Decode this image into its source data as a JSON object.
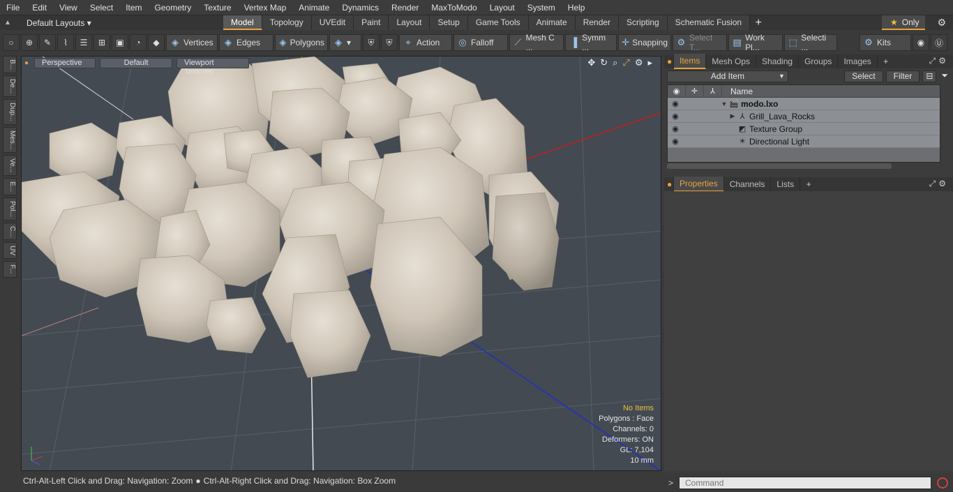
{
  "menu": [
    "File",
    "Edit",
    "View",
    "Select",
    "Item",
    "Geometry",
    "Texture",
    "Vertex Map",
    "Animate",
    "Dynamics",
    "Render",
    "MaxToModo",
    "Layout",
    "System",
    "Help"
  ],
  "layout_select": "Default Layouts ▾",
  "mode_tabs": [
    "Model",
    "Topology",
    "UVEdit",
    "Paint",
    "Layout",
    "Setup",
    "Game Tools",
    "Animate",
    "Render",
    "Scripting",
    "Schematic Fusion"
  ],
  "only_label": "Only",
  "toolbar": {
    "vertices": "Vertices",
    "edges": "Edges",
    "polygons": "Polygons",
    "action": "Action",
    "falloff": "Falloff",
    "mesh": "Mesh C ...",
    "symm": "Symm ...",
    "snapping": "Snapping",
    "select_t": "Select T...",
    "work_pl": "Work Pl...",
    "selecti": "Selecti ...",
    "kits": "Kits"
  },
  "left_tabs": [
    "B...",
    "De...",
    "Dup...",
    "Mes...",
    "Ve...",
    "E...",
    "Pol...",
    "C...",
    "UV",
    "F..."
  ],
  "viewport": {
    "view": "Perspective",
    "shading": "Default",
    "textures": "Viewport Textures",
    "info": {
      "items": "No Items",
      "polygons": "Polygons : Face",
      "channels": "Channels: 0",
      "deformers": "Deformers: ON",
      "gl": "GL: 7,104",
      "scale": "10 mm"
    }
  },
  "status": {
    "left": "Ctrl-Alt-Left Click and Drag: Navigation: Zoom",
    "right": "Ctrl-Alt-Right Click and Drag: Navigation: Box Zoom"
  },
  "items_panel": {
    "tabs": [
      "Items",
      "Mesh Ops",
      "Shading",
      "Groups",
      "Images"
    ],
    "add_item": "Add Item",
    "select": "Select",
    "filter": "Filter",
    "column_name": "Name",
    "rows": [
      {
        "label": "modo.lxo",
        "bold": true
      },
      {
        "label": "Grill_Lava_Rocks",
        "bold": false
      },
      {
        "label": "Texture Group",
        "bold": false
      },
      {
        "label": "Directional Light",
        "bold": false
      }
    ]
  },
  "props_panel": {
    "tabs": [
      "Properties",
      "Channels",
      "Lists"
    ]
  },
  "command_placeholder": "Command"
}
